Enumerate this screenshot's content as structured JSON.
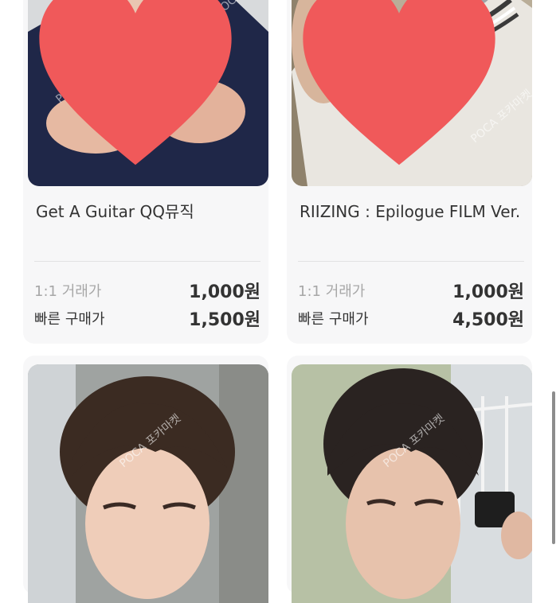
{
  "watermark": "POCA 포카마켓",
  "cards": [
    {
      "title": "Get A Guitar QQ뮤직",
      "row1_label": "1:1 거래가",
      "row1_price": "1,000원",
      "row2_label": "빠른 구매가",
      "row2_price": "1,500원",
      "favorited": true
    },
    {
      "title": "RIIZING : Epilogue FILM Ver.",
      "row1_label": "1:1 거래가",
      "row1_price": "1,000원",
      "row2_label": "빠른 구매가",
      "row2_price": "4,500원",
      "favorited": true
    },
    {
      "title": ""
    },
    {
      "title": ""
    }
  ],
  "colors": {
    "heart": "#f0595a",
    "card_bg": "#f7f7f8",
    "muted_text": "#a7a7a7"
  }
}
